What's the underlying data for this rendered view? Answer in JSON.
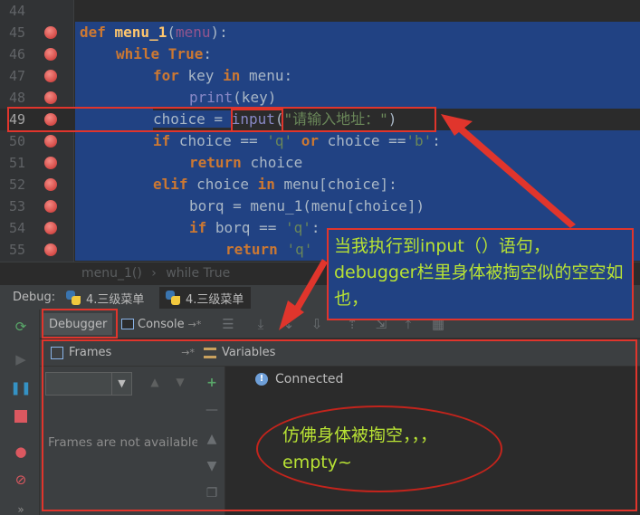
{
  "editor": {
    "lines": [
      {
        "num": "44"
      },
      {
        "num": "45"
      },
      {
        "num": "46"
      },
      {
        "num": "47"
      },
      {
        "num": "48"
      },
      {
        "num": "49"
      },
      {
        "num": "50"
      },
      {
        "num": "51"
      },
      {
        "num": "52"
      },
      {
        "num": "53"
      },
      {
        "num": "54"
      },
      {
        "num": "55"
      }
    ],
    "code": {
      "l45_def": "def ",
      "l45_fn": "menu_1",
      "l45_open": "(",
      "l45_param": "menu",
      "l45_close": "):",
      "l46_kw": "while True",
      "l46_rest": ":",
      "l47_kw1": "for ",
      "l47_var": "key ",
      "l47_kw2": "in ",
      "l47_rest": "menu:",
      "l48_builtin": "print",
      "l48_rest": "(key)",
      "l49_a": "choice = ",
      "l49_builtin": "input",
      "l49_b": "(",
      "l49_str": "\"请输入地址：\"",
      "l49_c": ")",
      "l50_kw": "if ",
      "l50_a": "choice == ",
      "l50_s1": "'q' ",
      "l50_kw2": "or ",
      "l50_b": "choice ==",
      "l50_s2": "'b'",
      "l50_c": ":",
      "l51_kw": "return ",
      "l51_rest": "choice",
      "l52_kw": "elif ",
      "l52_a": "choice ",
      "l52_kw2": "in ",
      "l52_b": "menu[choice]:",
      "l53_a": "borq = menu_1(menu[choice])",
      "l54_kw": "if ",
      "l54_a": "borq == ",
      "l54_s": "'q'",
      "l54_b": ":",
      "l55_kw": "return ",
      "l55_s": "'q'"
    }
  },
  "breadcrumb": {
    "item1": "menu_1()",
    "sep": "›",
    "item2": "while True"
  },
  "debug": {
    "label": "Debug:",
    "tabs": [
      {
        "label": "4.三级菜单"
      },
      {
        "label": "4.三级菜单"
      }
    ],
    "subtabs": {
      "debugger": "Debugger",
      "console": "Console",
      "console_suffix": "→*"
    },
    "frames": {
      "header": "Frames",
      "header_suffix": "→*",
      "empty": "Frames are not available"
    },
    "variables": {
      "header": "Variables",
      "status": "Connected"
    }
  },
  "annotations": {
    "note1": "当我执行到input（）语句，debugger栏里身体被掏空似的空空如也，",
    "note2_line1": "仿佛身体被掏空，，，",
    "note2_line2": "empty~"
  },
  "colors": {
    "keyword": "#cc7832",
    "selection": "#214283",
    "annotation_red": "#e0352c",
    "annotation_text": "#b8e234"
  }
}
